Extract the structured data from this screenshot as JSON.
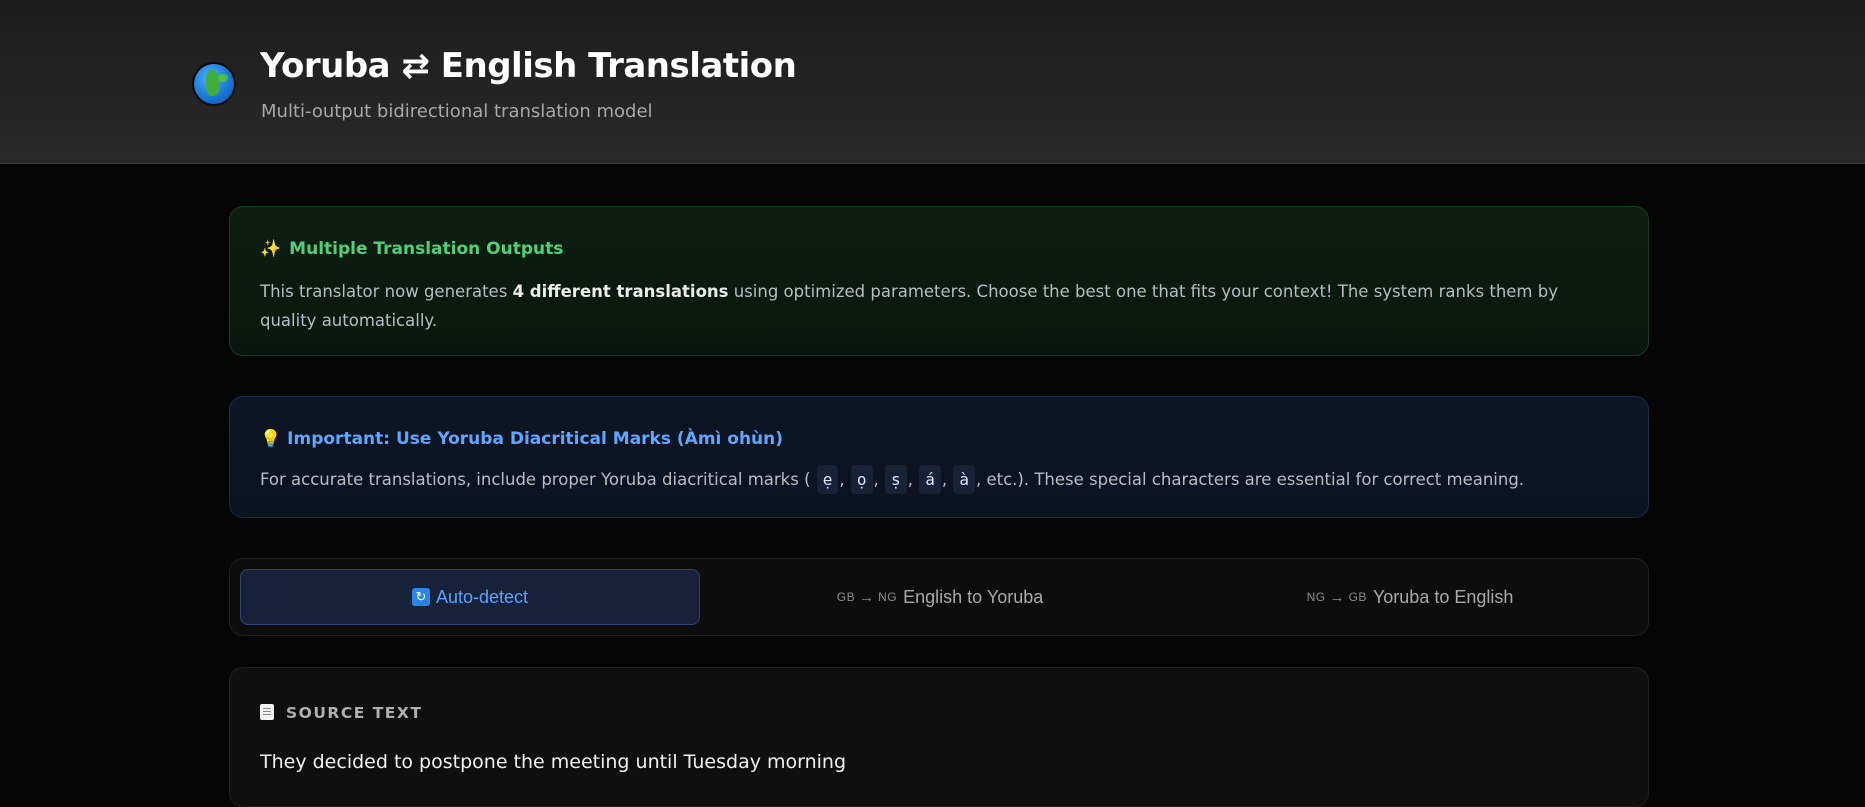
{
  "header": {
    "title": "Yoruba ⇄ English Translation",
    "subtitle": "Multi-output bidirectional translation model",
    "logo_icon": "globe-africa-icon"
  },
  "info_outputs": {
    "icon": "sparkles-icon",
    "heading": "Multiple Translation Outputs",
    "body_prefix": "This translator now generates ",
    "body_bold": "4 different translations",
    "body_suffix": " using optimized parameters. Choose the best one that fits your context! The system ranks them by quality automatically."
  },
  "info_diacritics": {
    "icon": "lightbulb-icon",
    "heading": "Important: Use Yoruba Diacritical Marks (Àmì ohùn)",
    "body_prefix": "For accurate translations, include proper Yoruba diacritical marks (",
    "marks": [
      "ẹ",
      "ọ",
      "ṣ",
      "á",
      "à"
    ],
    "body_suffix": ", etc.). These special characters are essential for correct meaning."
  },
  "direction_tabs": [
    {
      "label": "Auto-detect",
      "icon": "refresh-icon",
      "active": true
    },
    {
      "from_code": "GB",
      "to_code": "NG",
      "label": "English to Yoruba",
      "active": false
    },
    {
      "from_code": "NG",
      "to_code": "GB",
      "label": "Yoruba to English",
      "active": false
    }
  ],
  "source": {
    "icon": "memo-icon",
    "label": "SOURCE TEXT",
    "text": "They decided to postpone the meeting until Tuesday morning"
  },
  "colors": {
    "accent_green": "#4ed17a",
    "accent_blue": "#5ea7ff",
    "background": "#050505"
  }
}
